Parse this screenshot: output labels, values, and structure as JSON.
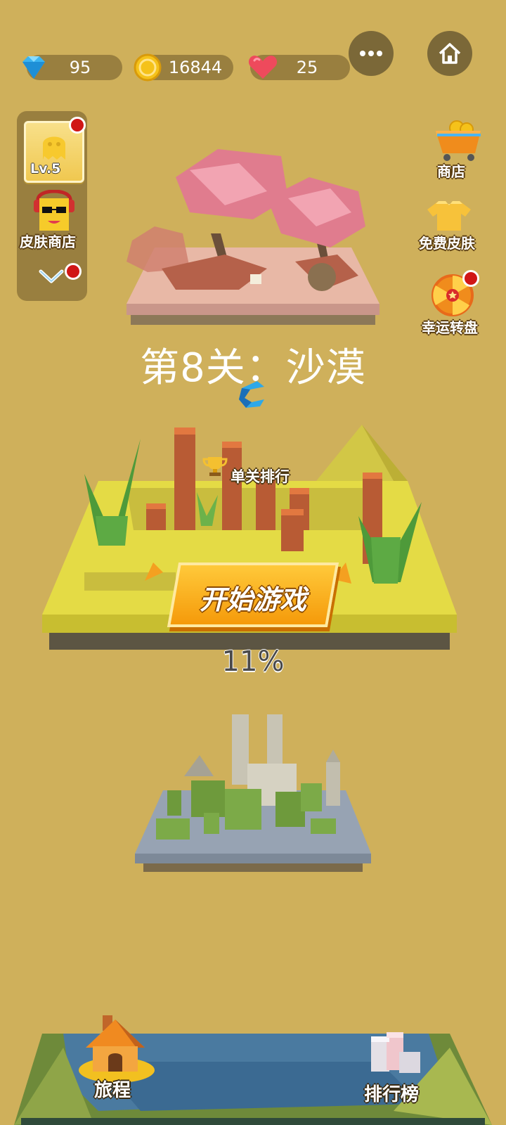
{
  "stats": {
    "gems": "95",
    "coins": "16844",
    "hearts": "25"
  },
  "top_buttons": {
    "more_icon": "more-icon",
    "home_icon": "home-icon"
  },
  "left_panel": {
    "level": "Lv.5",
    "skin_shop": "皮肤商店"
  },
  "right_panel": {
    "shop": "商店",
    "free_skin": "免费皮肤",
    "lucky_wheel": "幸运转盘"
  },
  "level": {
    "title": "第8关：沙漠",
    "rank_label": "单关排行",
    "start_button": "开始游戏",
    "progress": "11%",
    "progress_value": 0.11
  },
  "bottom_nav": {
    "journey": "旅程",
    "leaderboard": "排行榜"
  },
  "colors": {
    "background": "#CFB05B",
    "pill": "#7B6838",
    "accent_orange": "#F59A0A",
    "badge_red": "#D01616"
  }
}
